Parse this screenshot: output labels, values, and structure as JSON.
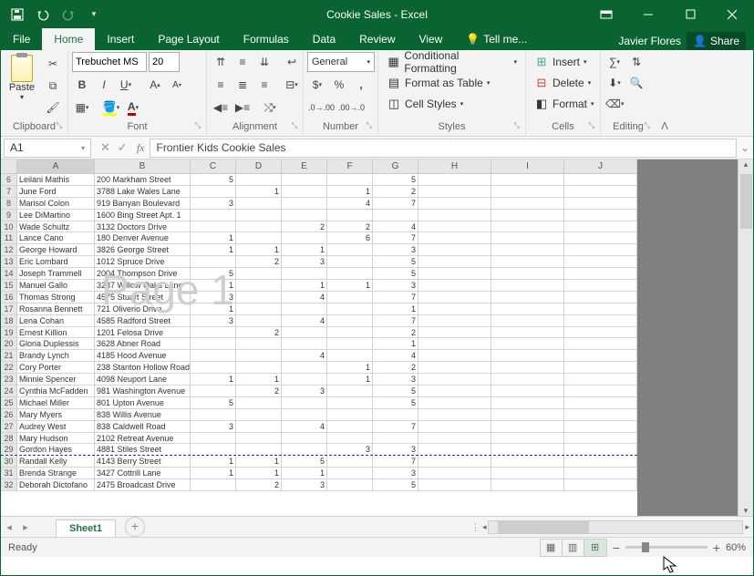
{
  "title": "Cookie Sales - Excel",
  "user": "Javier Flores",
  "share": "Share",
  "tabs": [
    "File",
    "Home",
    "Insert",
    "Page Layout",
    "Formulas",
    "Data",
    "Review",
    "View"
  ],
  "tell_me": "Tell me...",
  "ribbon": {
    "clipboard": {
      "paste": "Paste",
      "label": "Clipboard"
    },
    "font": {
      "name": "Trebuchet MS",
      "size": "20",
      "label": "Font"
    },
    "alignment_label": "Alignment",
    "number": {
      "format": "General",
      "label": "Number"
    },
    "styles": {
      "cf": "Conditional Formatting",
      "ft": "Format as Table",
      "cs": "Cell Styles",
      "label": "Styles"
    },
    "cells": {
      "insert": "Insert",
      "delete": "Delete",
      "format": "Format",
      "label": "Cells"
    },
    "editing_label": "Editing"
  },
  "namebox": "A1",
  "formula": "Frontier Kids Cookie Sales",
  "watermark": "Page 1",
  "cols": {
    "A": 85,
    "B": 105,
    "C": 50,
    "D": 50,
    "E": 50,
    "F": 50,
    "G": 50,
    "H": 80,
    "I": 80,
    "J": 80
  },
  "rows": [
    {
      "n": 6,
      "A": "Leilani Mathis",
      "B": "200 Markham Street",
      "C": "5",
      "G": "5"
    },
    {
      "n": 7,
      "A": "June Ford",
      "B": "3788 Lake Wales Lane",
      "D": "1",
      "F": "1",
      "G": "2"
    },
    {
      "n": 8,
      "A": "Marisol Colon",
      "B": "919 Banyan Boulevard",
      "C": "3",
      "F": "4",
      "G": "7"
    },
    {
      "n": 9,
      "A": "Lee DiMartino",
      "B": "1600 Bing Street Apt. 1",
      "G": ""
    },
    {
      "n": 10,
      "A": "Wade Schultz",
      "B": "3132 Doctors Drive",
      "E": "2",
      "F": "2",
      "G": "4"
    },
    {
      "n": 11,
      "A": "Lance Cano",
      "B": "180 Denver Avenue",
      "C": "1",
      "F": "6",
      "G": "7"
    },
    {
      "n": 12,
      "A": "George Howard",
      "B": "3826 George Street",
      "C": "1",
      "D": "1",
      "E": "1",
      "G": "3"
    },
    {
      "n": 13,
      "A": "Eric Lombard",
      "B": "1012 Spruce Drive",
      "D": "2",
      "E": "3",
      "G": "5"
    },
    {
      "n": 14,
      "A": "Joseph Trammell",
      "B": "2004 Thompson Drive",
      "C": "5",
      "G": "5"
    },
    {
      "n": 15,
      "A": "Manuel Gallo",
      "B": "3237 Willow Oaks Lane",
      "C": "1",
      "E": "1",
      "F": "1",
      "G": "3"
    },
    {
      "n": 16,
      "A": "Thomas Strong",
      "B": "4575 Stuart Street",
      "C": "3",
      "E": "4",
      "G": "7"
    },
    {
      "n": 17,
      "A": "Rosanna Bennett",
      "B": "721 Oliverio Drive",
      "C": "1",
      "G": "1"
    },
    {
      "n": 18,
      "A": "Lena Cohan",
      "B": "4585 Radford Street",
      "C": "3",
      "E": "4",
      "G": "7"
    },
    {
      "n": 19,
      "A": "Ernest Killion",
      "B": "1201 Felosa Drive",
      "D": "2",
      "G": "2"
    },
    {
      "n": 20,
      "A": "Gloria Duplessis",
      "B": "3628 Abner Road",
      "G": "1"
    },
    {
      "n": 21,
      "A": "Brandy Lynch",
      "B": "4185 Hood Avenue",
      "E": "4",
      "G": "4"
    },
    {
      "n": 22,
      "A": "Cory Porter",
      "B": "238 Stanton Hollow Road",
      "F": "1",
      "G": "2"
    },
    {
      "n": 23,
      "A": "Minnie Spencer",
      "B": "4098 Neuport Lane",
      "C": "1",
      "D": "1",
      "F": "1",
      "G": "3"
    },
    {
      "n": 24,
      "A": "Cynthia McFadden",
      "B": "981 Washington Avenue",
      "D": "2",
      "E": "3",
      "G": "5"
    },
    {
      "n": 25,
      "A": "Michael Miller",
      "B": "801 Upton Avenue",
      "C": "5",
      "G": "5"
    },
    {
      "n": 26,
      "A": "Mary Myers",
      "B": "838 Willis Avenue",
      "G": ""
    },
    {
      "n": 27,
      "A": "Audrey West",
      "B": "838 Caldwell Road",
      "C": "3",
      "E": "4",
      "G": "7"
    },
    {
      "n": 28,
      "A": "Mary Hudson",
      "B": "2102 Retreat Avenue",
      "G": ""
    },
    {
      "n": 29,
      "A": "Gordon Hayes",
      "B": "4881 Stiles Street",
      "F": "3",
      "G": "3",
      "pb": true
    },
    {
      "n": 30,
      "A": "Randall Kelly",
      "B": "4143 Berry Street",
      "C": "1",
      "D": "1",
      "E": "5",
      "G": "7"
    },
    {
      "n": 31,
      "A": "Brenda Strange",
      "B": "3427 Cottrill Lane",
      "C": "1",
      "D": "1",
      "E": "1",
      "G": "3"
    },
    {
      "n": 32,
      "A": "Deborah Dictofano",
      "B": "2475 Broadcast Drive",
      "D": "2",
      "E": "3",
      "G": "5"
    }
  ],
  "sheet_name": "Sheet1",
  "status": "Ready",
  "zoom": "60%"
}
